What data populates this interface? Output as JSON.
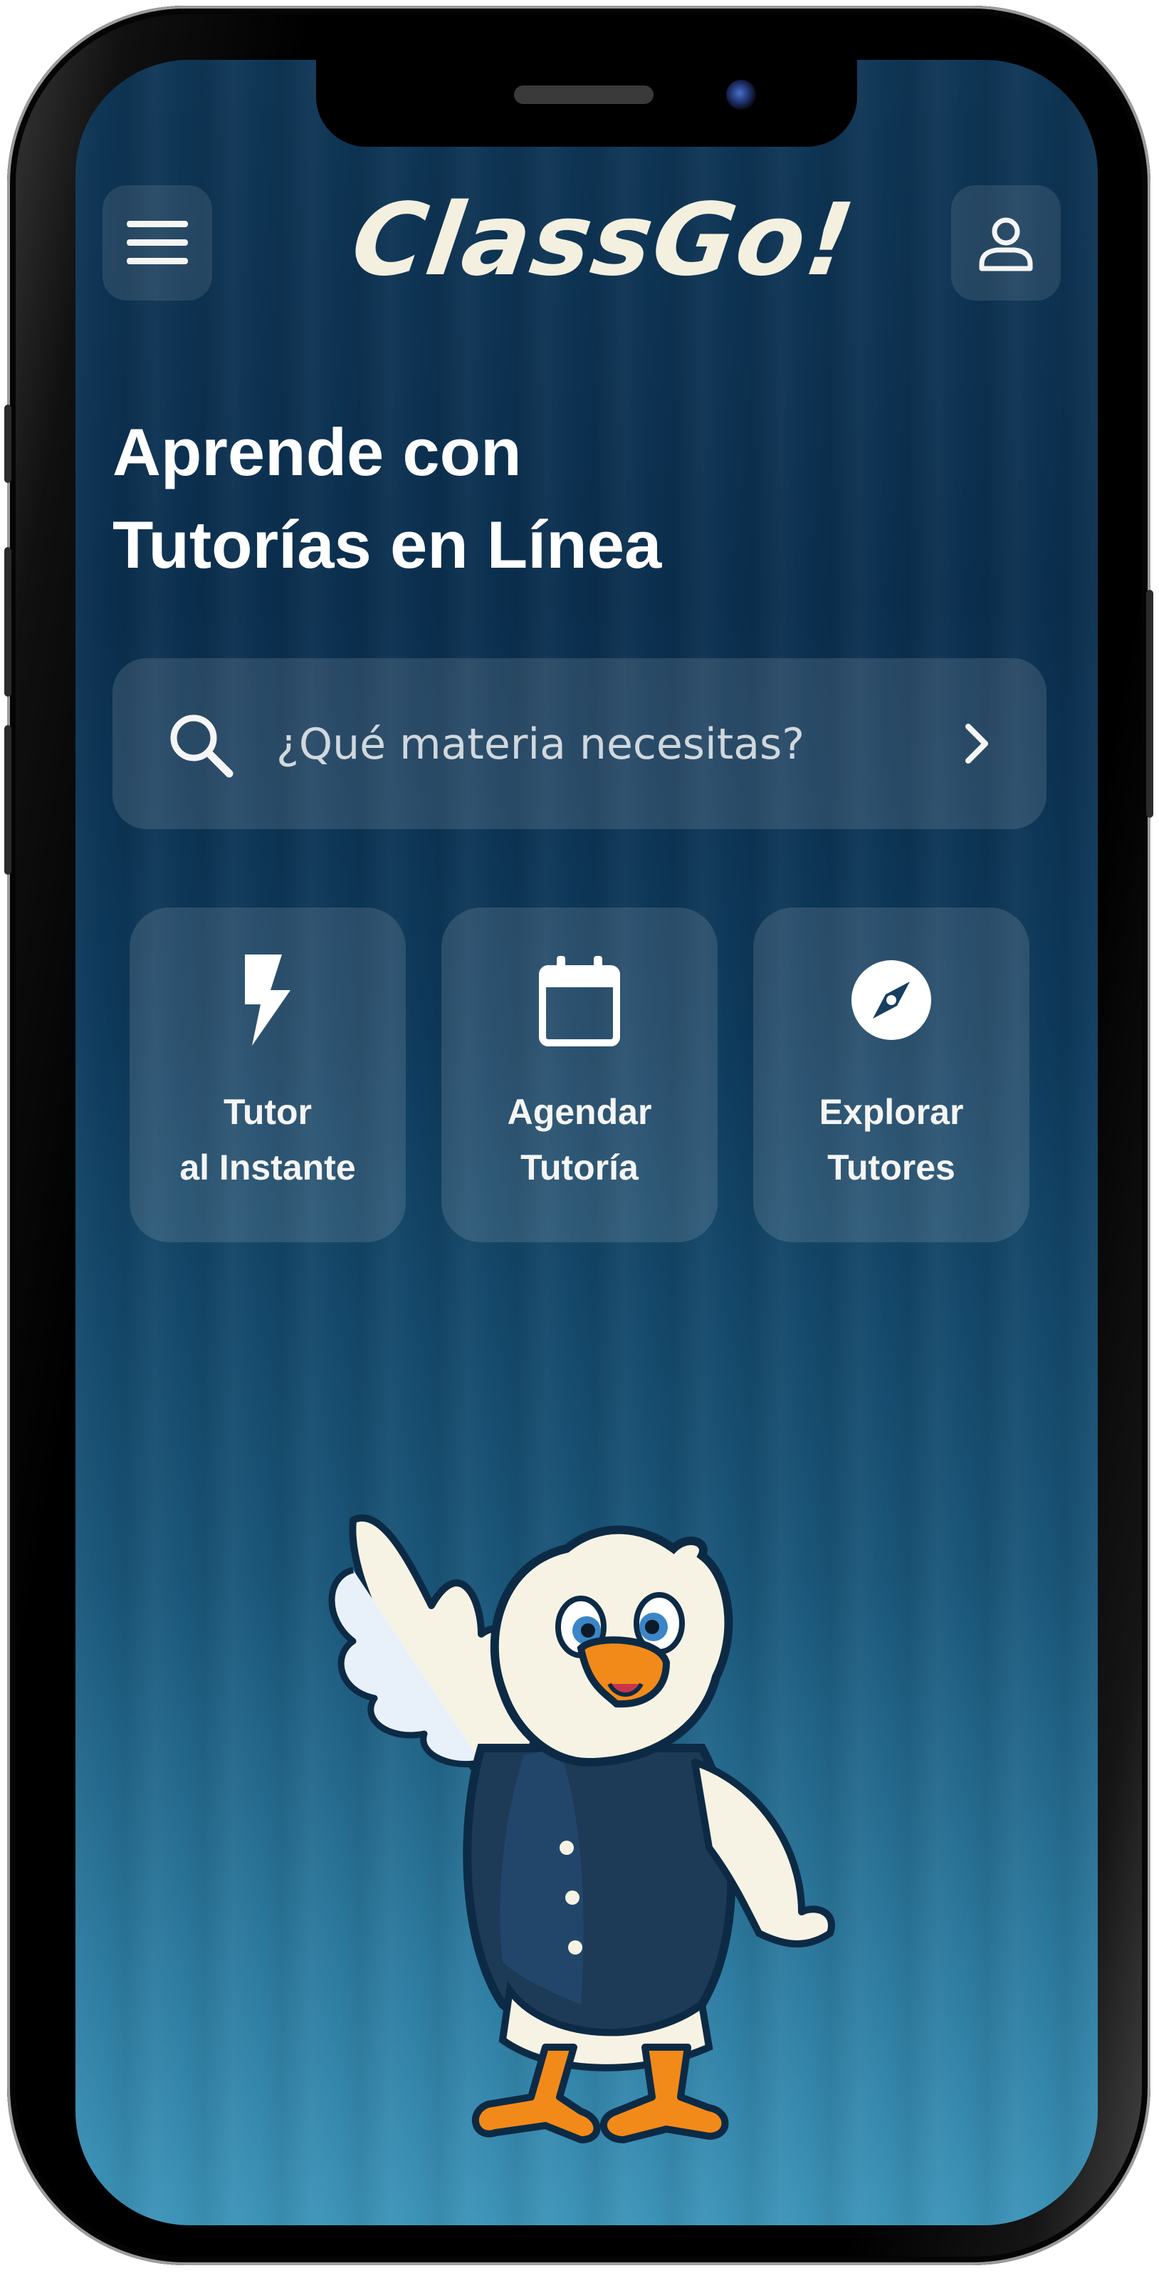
{
  "header": {
    "logo_text": "ClassGo!"
  },
  "hero": {
    "headline_line1": "Aprende con",
    "headline_line2": "Tutorías en Línea"
  },
  "search": {
    "placeholder": "¿Qué materia necesitas?"
  },
  "actions": [
    {
      "label": "Tutor\nal Instante",
      "icon": "lightning-icon"
    },
    {
      "label": "Agendar\nTutoría",
      "icon": "calendar-icon"
    },
    {
      "label": "Explorar\nTutores",
      "icon": "compass-icon"
    }
  ],
  "colors": {
    "background_top": "#0b2f4f",
    "background_bottom": "#3d94b8",
    "text": "#ffffff",
    "logo": "#f4f0e0",
    "mascot_beak": "#f28a1a"
  }
}
